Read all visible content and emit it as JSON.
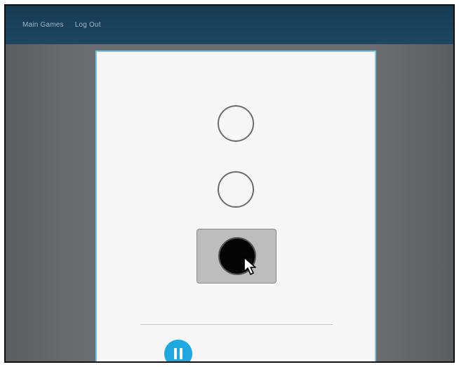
{
  "topbar": {
    "links": [
      {
        "label": "Main Games"
      },
      {
        "label": "Log Out"
      }
    ]
  },
  "dialog": {
    "options": [
      {
        "state": "empty"
      },
      {
        "state": "empty"
      },
      {
        "state": "filled-selected"
      }
    ]
  },
  "controls": {
    "pause_icon": "pause-icon"
  },
  "colors": {
    "topbar": "#163a52",
    "backdrop": "#6b6e70",
    "dialog_border": "#7fc6e6",
    "accent": "#1fa8e0",
    "selected_fill": "#bdbdbd"
  }
}
